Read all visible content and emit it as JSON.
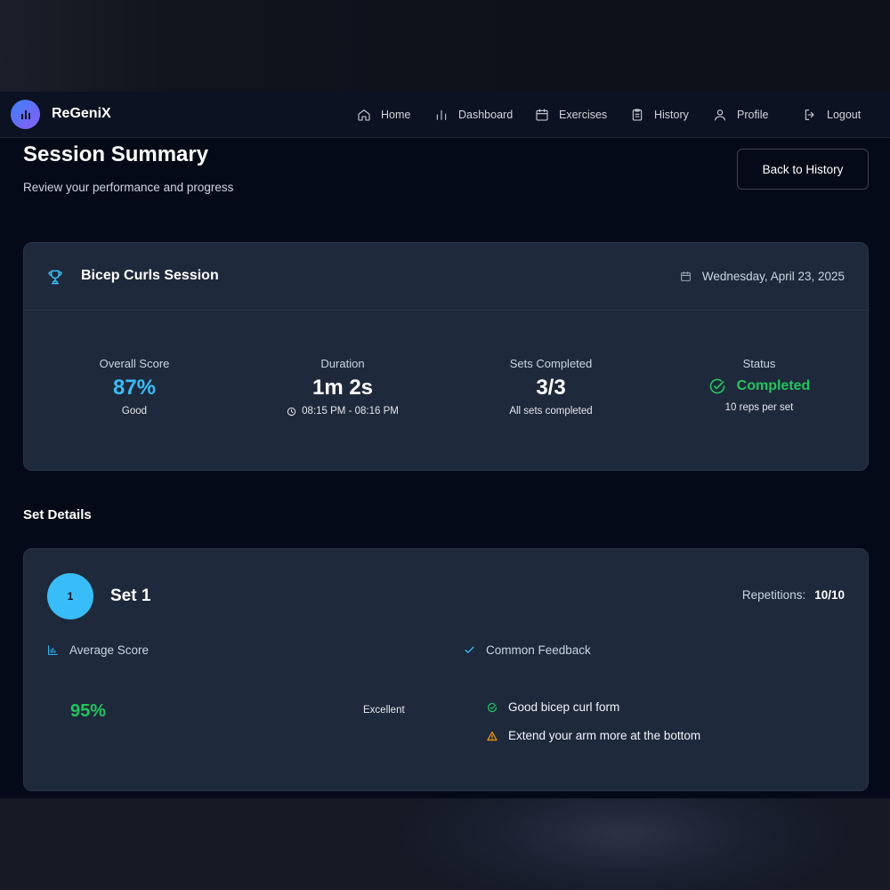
{
  "brand": {
    "name": "ReGeniX",
    "icon": "bar-chart-icon"
  },
  "nav": {
    "items": [
      {
        "label": "Home",
        "icon": "home-icon"
      },
      {
        "label": "Dashboard",
        "icon": "bar-chart-icon"
      },
      {
        "label": "Exercises",
        "icon": "calendar-icon"
      },
      {
        "label": "History",
        "icon": "clipboard-icon"
      },
      {
        "label": "Profile",
        "icon": "user-icon"
      },
      {
        "label": "Logout",
        "icon": "logout-icon"
      }
    ]
  },
  "header": {
    "title": "Session Summary",
    "subtitle": "Review your performance and progress",
    "back_button": "Back to History"
  },
  "session": {
    "name": "Bicep Curls Session",
    "date": "Wednesday, April 23, 2025",
    "stats": [
      {
        "label": "Overall Score",
        "value": "87%",
        "sub": "Good"
      },
      {
        "label": "Duration",
        "value": "1m 2s",
        "sub": "08:15 PM - 08:16 PM"
      },
      {
        "label": "Sets Completed",
        "value": "3/3",
        "sub": "All sets completed"
      },
      {
        "label": "Status",
        "value": "Completed",
        "sub": "10 reps per set"
      }
    ]
  },
  "set_details": {
    "title": "Set Details",
    "sets": [
      {
        "number": "1",
        "title": "Set 1",
        "repetitions_label": "Repetitions:",
        "repetitions": "10/10",
        "average_label": "Average Score",
        "average_value": "95%",
        "average_rating": "Excellent",
        "feedback_label": "Common Feedback",
        "feedback": [
          {
            "text": "Good bicep curl form",
            "type": "success"
          },
          {
            "text": "Extend your arm more at the bottom",
            "type": "warning"
          }
        ]
      }
    ]
  },
  "colors": {
    "accent_blue": "#38bdf8",
    "success_green": "#22c55e",
    "warning_amber": "#f59e0b",
    "card_bg": "#1e293b",
    "page_bg": "#050a18"
  }
}
